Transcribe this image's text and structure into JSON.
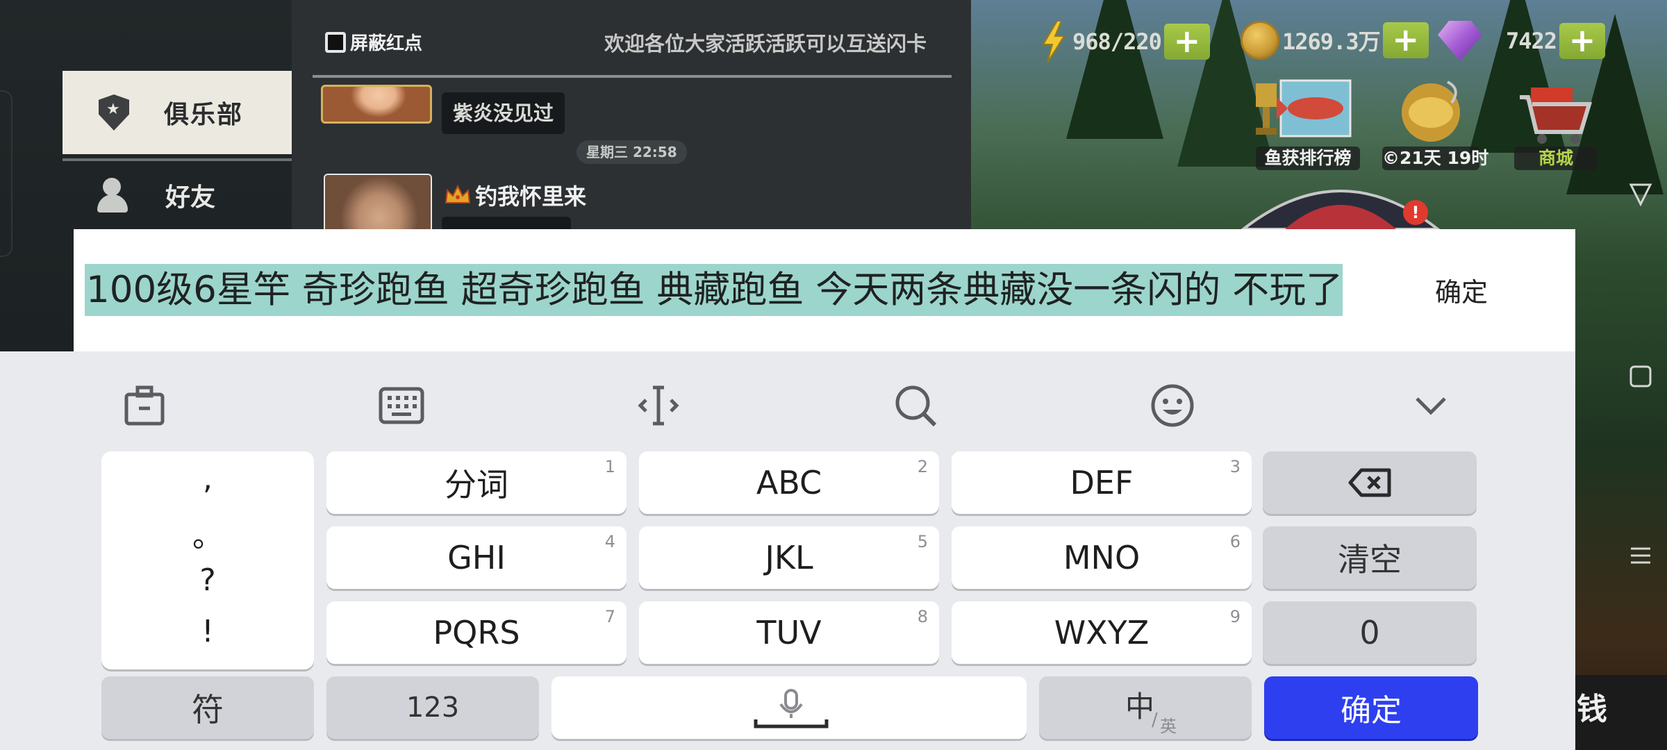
{
  "game": {
    "sidebar": {
      "club_label": "俱乐部",
      "friends_label": "好友"
    },
    "chat": {
      "block_red_dot_label": "屏蔽红点",
      "welcome_text": "欢迎各位大家活跃活跃可以互送闪卡",
      "message1_text": "紫炎没见过",
      "timestamp": "星期三 22:58",
      "user2_name": "钓我怀里来"
    },
    "hud": {
      "energy": "968/220",
      "coins": "1269.3万",
      "gems": "7422",
      "plus_label": "+",
      "leaderboard_label": "鱼获排行榜",
      "event_label": "©21天 19时",
      "shop_label": "商城",
      "bottom_right_char": "钱"
    }
  },
  "input": {
    "text": "100级6星竿 奇珍跑鱼 超奇珍跑鱼 典藏跑鱼 今天两条典藏没一条闪的 不玩了",
    "confirm_label": "确定"
  },
  "keyboard": {
    "toolbar": [
      "clipboard-icon",
      "keyboard-icon",
      "cursor-icon",
      "search-icon",
      "emoji-icon",
      "chevron-down-icon"
    ],
    "punctuation": [
      ",",
      "。",
      "?",
      "!"
    ],
    "keys": [
      {
        "label": "分词",
        "num": "1"
      },
      {
        "label": "ABC",
        "num": "2"
      },
      {
        "label": "DEF",
        "num": "3"
      },
      {
        "label": "GHI",
        "num": "4"
      },
      {
        "label": "JKL",
        "num": "5"
      },
      {
        "label": "MNO",
        "num": "6"
      },
      {
        "label": "PQRS",
        "num": "7"
      },
      {
        "label": "TUV",
        "num": "8"
      },
      {
        "label": "WXYZ",
        "num": "9"
      }
    ],
    "clear_label": "清空",
    "zero_label": "0",
    "symbols_label": "符",
    "numbers_label": "123",
    "lang_main": "中",
    "lang_sub": "英",
    "enter_label": "确定",
    "accent_color": "#2e3ff0"
  }
}
